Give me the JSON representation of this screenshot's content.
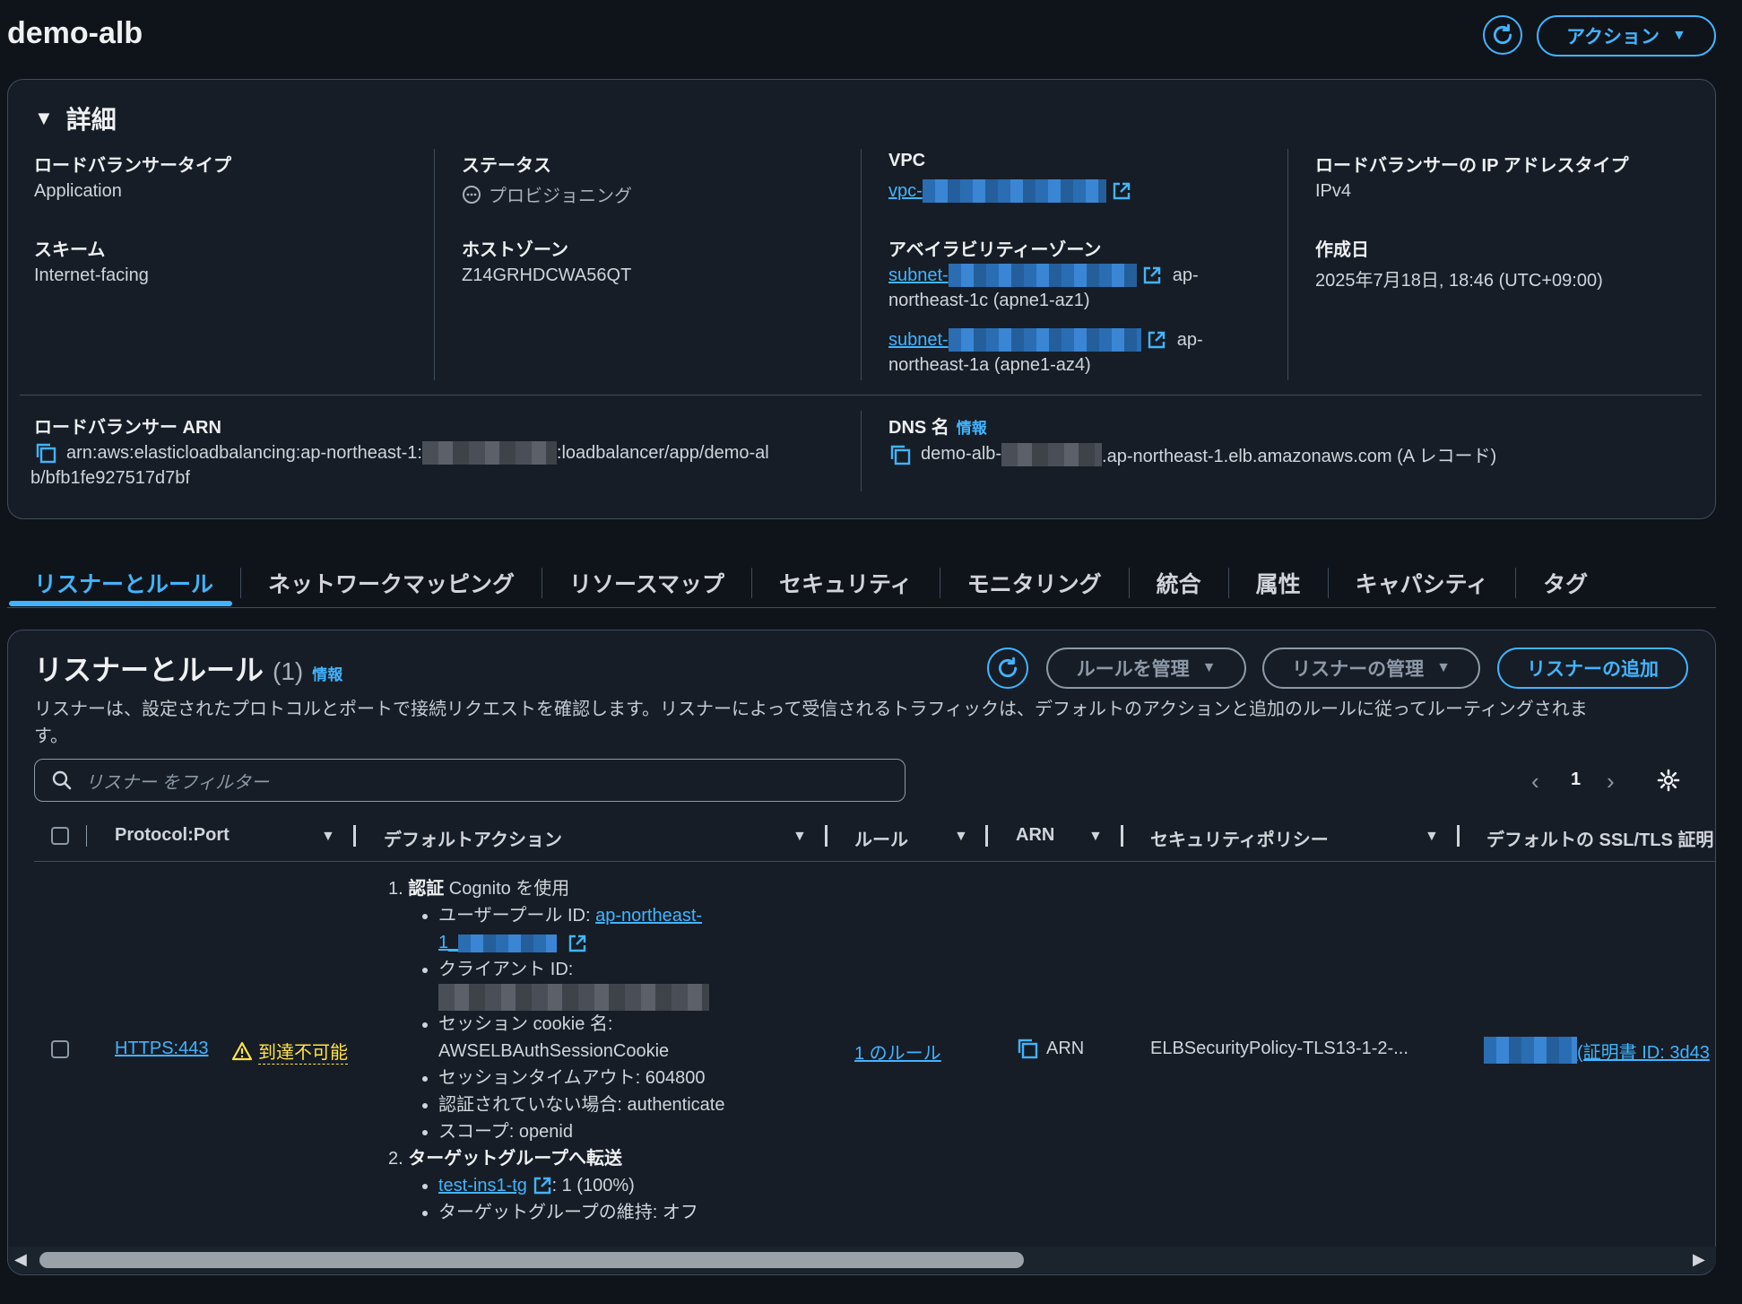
{
  "header": {
    "title": "demo-alb",
    "actions_label": "アクション"
  },
  "details": {
    "section_title": "詳細",
    "lb_type_label": "ロードバランサータイプ",
    "lb_type_value": "Application",
    "status_label": "ステータス",
    "status_value": "プロビジョニング",
    "vpc_label": "VPC",
    "vpc_value": "vpc-",
    "ip_type_label": "ロードバランサーの IP アドレスタイプ",
    "ip_type_value": "IPv4",
    "scheme_label": "スキーム",
    "scheme_value": "Internet-facing",
    "hosted_zone_label": "ホストゾーン",
    "hosted_zone_value": "Z14GRHDCWA56QT",
    "az_label": "アベイラビリティーゾーン",
    "az1_subnet": "subnet-",
    "az1_suffix_1": "ap-",
    "az1_suffix_2": "northeast-1c (apne1-az1)",
    "az2_subnet": "subnet-",
    "az2_suffix_1": "ap-",
    "az2_suffix_2": "northeast-1a (apne1-az4)",
    "created_label": "作成日",
    "created_value": "2025年7月18日, 18:46 (UTC+09:00)",
    "arn_label": "ロードバランサー ARN",
    "arn_part1": "arn:aws:elasticloadbalancing:ap-northeast-1:",
    "arn_part2": ":loadbalancer/app/demo-al",
    "arn_part3": "b/bfb1fe927517d7bf",
    "dns_label": "DNS 名",
    "dns_info": "情報",
    "dns_part1": "demo-alb-",
    "dns_part2": ".ap-northeast-1.elb.amazonaws.com (A レコード)"
  },
  "tabs": [
    "リスナーとルール",
    "ネットワークマッピング",
    "リソースマップ",
    "セキュリティ",
    "モニタリング",
    "統合",
    "属性",
    "キャパシティ",
    "タグ"
  ],
  "listeners": {
    "title": "リスナーとルール",
    "count": "(1)",
    "info": "情報",
    "manage_rules": "ルールを管理",
    "manage_listeners": "リスナーの管理",
    "add_listener": "リスナーの追加",
    "description_1": "リスナーは、設定されたプロトコルとポートで接続リクエストを確認します。リスナーによって受信されるトラフィックは、デフォルトのアクションと追加のルールに従ってルーティングされま",
    "description_2": "す。",
    "filter_placeholder": "リスナー をフィルター",
    "page": "1",
    "columns": [
      "Protocol:Port",
      "デフォルトアクション",
      "ルール",
      "ARN",
      "セキュリティポリシー",
      "デフォルトの SSL/TLS 証明"
    ],
    "row": {
      "protocol_port": "HTTPS:443",
      "warning": "到達不可能",
      "action1_num": "1.",
      "action1_bold": "認証",
      "action1_rest": " Cognito を使用",
      "userpool_label": "ユーザープール ID: ",
      "userpool_link": "ap-northeast-",
      "userpool_link2": "1_",
      "client_id_label": "クライアント ID:",
      "cookie_label": "セッション cookie 名:",
      "cookie_value": "AWSELBAuthSessionCookie",
      "timeout": "セッションタイムアウト: 604800",
      "unauth": "認証されていない場合: authenticate",
      "scope": "スコープ: openid",
      "action2_num": "2.",
      "action2_bold": "ターゲットグループへ転送",
      "tg_link": "test-ins1-tg",
      "tg_weight": ": 1 (100%)",
      "tg_stickiness": "ターゲットグループの維持: オフ",
      "rules": "1 のルール",
      "arn": "ARN",
      "policy": "ELBSecurityPolicy-TLS13-1-2-...",
      "cert": "(証明書 ID: 3d43"
    }
  }
}
